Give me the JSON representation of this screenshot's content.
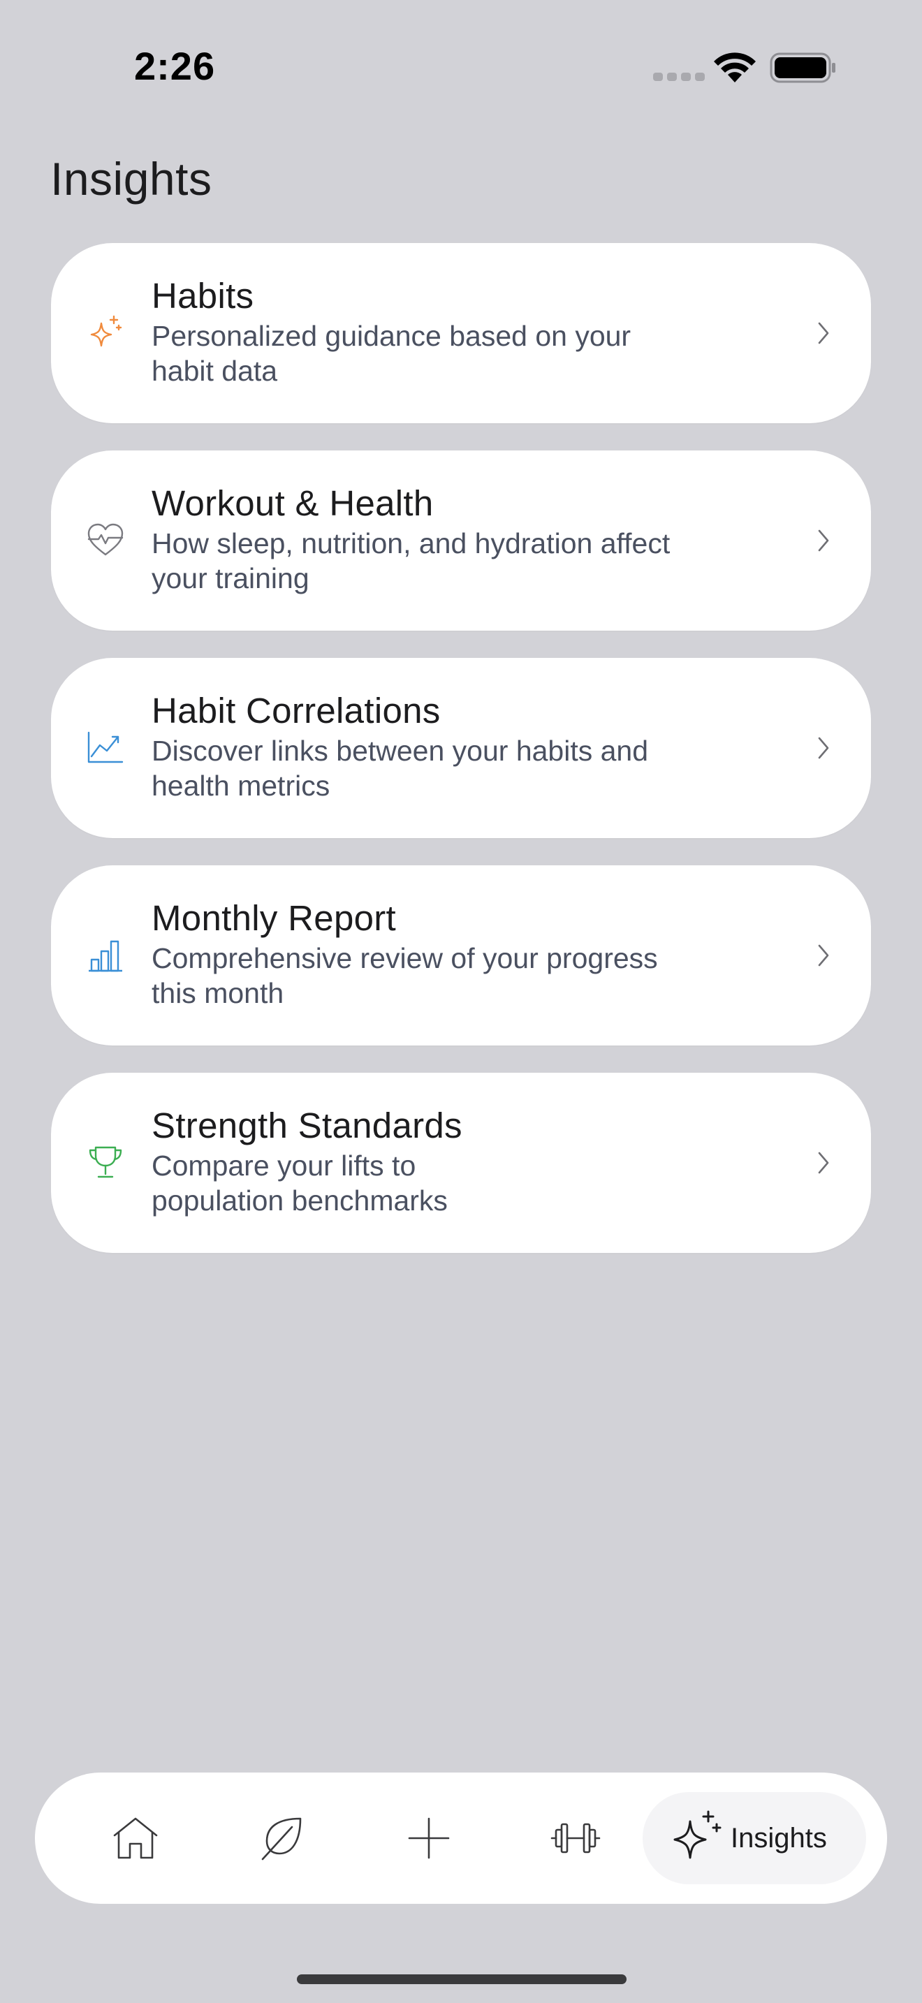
{
  "status_bar": {
    "time": "2:26"
  },
  "page": {
    "title": "Insights"
  },
  "cards": [
    {
      "title": "Habits",
      "subtitle_line1": "Personalized guidance based on your",
      "subtitle_line2": "habit data",
      "icon": "sparkles-icon",
      "icon_color": "#f08a3c"
    },
    {
      "title": "Workout & Health",
      "subtitle_line1": "How sleep, nutrition, and hydration affect",
      "subtitle_line2": "your training",
      "icon": "heart-pulse-icon",
      "icon_color": "#7a7a80"
    },
    {
      "title": "Habit Correlations",
      "subtitle_line1": "Discover links between your habits and",
      "subtitle_line2": "health metrics",
      "icon": "trend-chart-icon",
      "icon_color": "#3a8fd6"
    },
    {
      "title": "Monthly Report",
      "subtitle_line1": "Comprehensive review of your progress",
      "subtitle_line2": "this month",
      "icon": "bar-chart-icon",
      "icon_color": "#3a8fd6"
    },
    {
      "title": "Strength Standards",
      "subtitle_line1": "Compare your lifts to",
      "subtitle_line2": "population benchmarks",
      "icon": "trophy-icon",
      "icon_color": "#3cae52"
    }
  ],
  "tab_bar": {
    "tabs": [
      {
        "icon": "home-icon"
      },
      {
        "icon": "leaf-icon"
      },
      {
        "icon": "plus-icon"
      },
      {
        "icon": "dumbbell-icon"
      },
      {
        "icon": "sparkles-icon",
        "label": "Insights",
        "selected": true
      }
    ]
  }
}
